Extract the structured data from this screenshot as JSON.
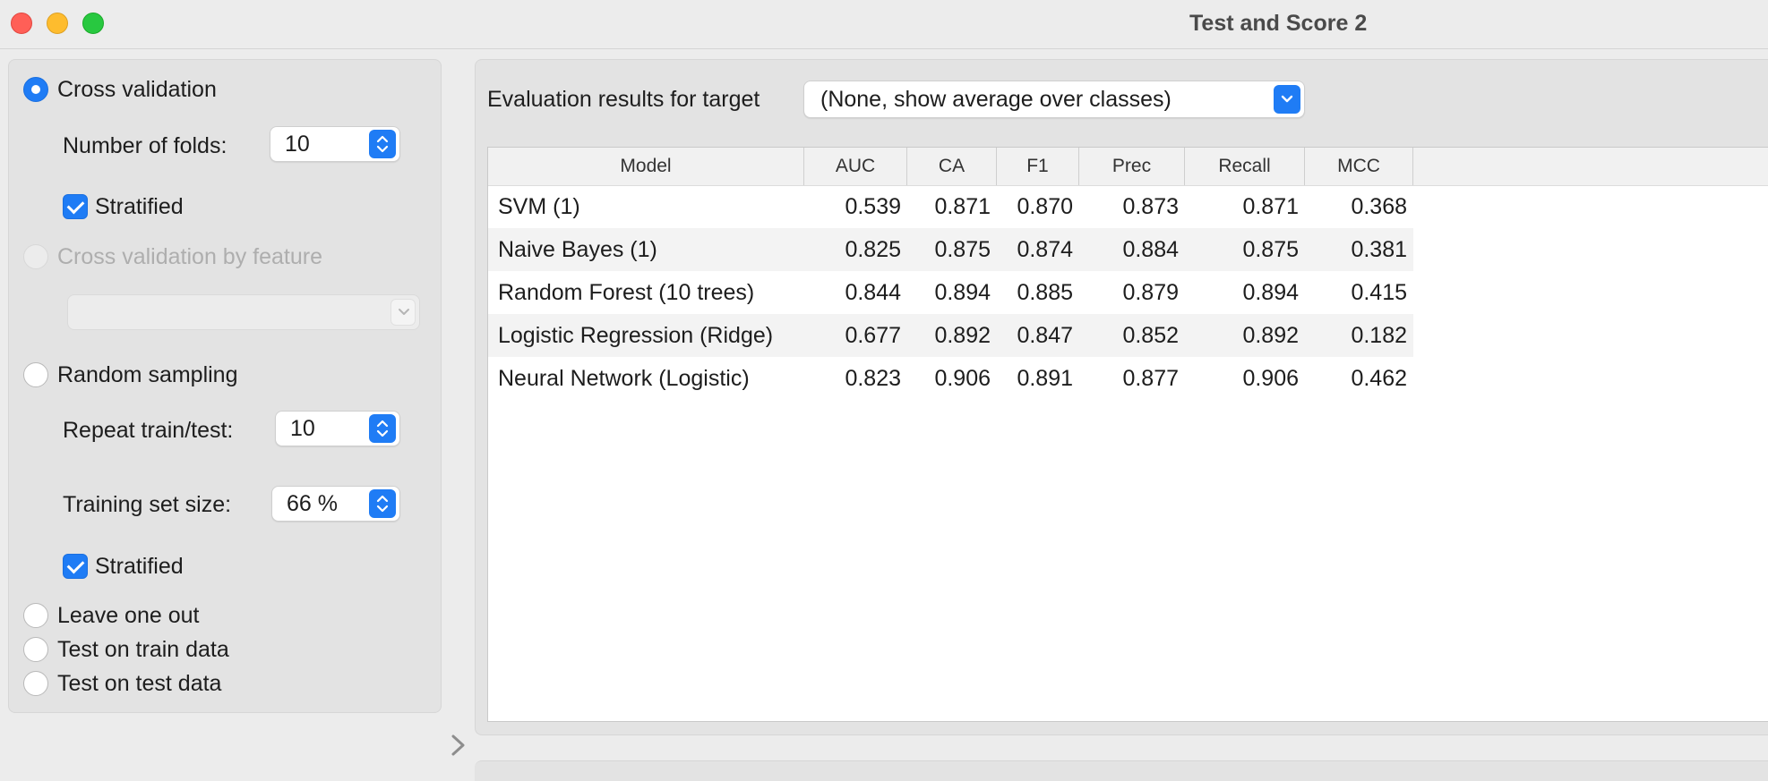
{
  "window": {
    "title": "Test and Score 2"
  },
  "sampling": {
    "cross_validation": {
      "label": "Cross validation",
      "selected": true
    },
    "folds": {
      "label": "Number of folds:",
      "value": "10"
    },
    "stratified_cv": {
      "label": "Stratified",
      "checked": true
    },
    "cv_by_feature": {
      "label": "Cross validation by feature",
      "enabled": false
    },
    "feature_combo": {
      "value": ""
    },
    "random_sampling": {
      "label": "Random sampling",
      "selected": false
    },
    "repeat": {
      "label": "Repeat train/test:",
      "value": "10"
    },
    "training_size": {
      "label": "Training set size:",
      "value": "66 %"
    },
    "stratified_rs": {
      "label": "Stratified",
      "checked": true
    },
    "leave_one_out": {
      "label": "Leave one out"
    },
    "train_data": {
      "label": "Test on train data"
    },
    "test_data": {
      "label": "Test on test data"
    }
  },
  "results": {
    "target_label": "Evaluation results for target",
    "target_value": "(None, show average over classes)",
    "columns": [
      "Model",
      "AUC",
      "CA",
      "F1",
      "Prec",
      "Recall",
      "MCC"
    ],
    "rows": [
      [
        "SVM (1)",
        "0.539",
        "0.871",
        "0.870",
        "0.873",
        "0.871",
        "0.368"
      ],
      [
        "Naive Bayes (1)",
        "0.825",
        "0.875",
        "0.874",
        "0.884",
        "0.875",
        "0.381"
      ],
      [
        "Random Forest (10 trees)",
        "0.844",
        "0.894",
        "0.885",
        "0.879",
        "0.894",
        "0.415"
      ],
      [
        "Logistic Regression (Ridge)",
        "0.677",
        "0.892",
        "0.847",
        "0.852",
        "0.892",
        "0.182"
      ],
      [
        "Neural Network (Logistic)",
        "0.823",
        "0.906",
        "0.891",
        "0.877",
        "0.906",
        "0.462"
      ]
    ]
  },
  "colors": {
    "accent": "#1f7cf5",
    "close": "#ff5f57",
    "minimize": "#febc2e",
    "zoom": "#28c840"
  }
}
